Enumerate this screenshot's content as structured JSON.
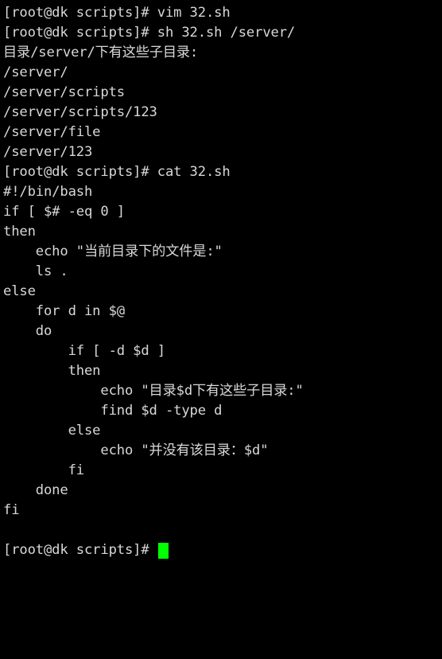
{
  "terminal": {
    "background_color": "#000000",
    "foreground_color": "#d8d8d8",
    "cursor_color": "#00ff00",
    "prompt": "[root@dk scripts]# ",
    "lines": [
      {
        "id": "cmd-vim",
        "text": "[root@dk scripts]# vim 32.sh"
      },
      {
        "id": "cmd-sh-run",
        "text": "[root@dk scripts]# sh 32.sh /server/"
      },
      {
        "id": "out-header",
        "text": "目录/server/下有这些子目录:"
      },
      {
        "id": "out-path-1",
        "text": "/server/"
      },
      {
        "id": "out-path-2",
        "text": "/server/scripts"
      },
      {
        "id": "out-path-3",
        "text": "/server/scripts/123"
      },
      {
        "id": "out-path-4",
        "text": "/server/file"
      },
      {
        "id": "out-path-5",
        "text": "/server/123"
      },
      {
        "id": "cmd-cat",
        "text": "[root@dk scripts]# cat 32.sh"
      },
      {
        "id": "script-shebang",
        "text": "#!/bin/bash"
      },
      {
        "id": "script-if",
        "text": "if [ $# -eq 0 ]"
      },
      {
        "id": "script-then",
        "text": "then"
      },
      {
        "id": "script-echo-1",
        "text": "    echo \"当前目录下的文件是:\""
      },
      {
        "id": "script-ls",
        "text": "    ls ."
      },
      {
        "id": "script-else-outer",
        "text": "else"
      },
      {
        "id": "script-for",
        "text": "    for d in $@"
      },
      {
        "id": "script-do",
        "text": "    do"
      },
      {
        "id": "script-if-inner",
        "text": "        if [ -d $d ]"
      },
      {
        "id": "script-then-inner",
        "text": "        then"
      },
      {
        "id": "script-echo-2",
        "text": "            echo \"目录$d下有这些子目录:\""
      },
      {
        "id": "script-find",
        "text": "            find $d -type d"
      },
      {
        "id": "script-else-inner",
        "text": "        else"
      },
      {
        "id": "script-echo-3",
        "text": "            echo \"并没有该目录：$d\""
      },
      {
        "id": "script-fi-inner",
        "text": "        fi"
      },
      {
        "id": "script-done",
        "text": "    done"
      },
      {
        "id": "script-fi-outer",
        "text": "fi"
      },
      {
        "id": "blank-1",
        "text": ""
      }
    ]
  }
}
